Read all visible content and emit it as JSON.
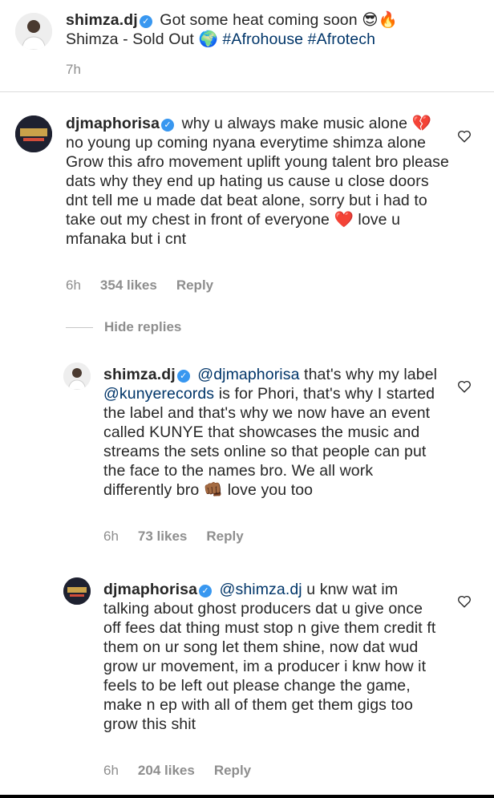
{
  "caption": {
    "username": "shimza.dj",
    "text_part1": "Got some heat coming soon",
    "emoji_part1": "😎🔥",
    "text_part2": "Shimza - Sold Out",
    "emoji_globe": "🌍",
    "hashtag1": "#Afrohouse",
    "hashtag2": "#Afrotech",
    "time": "7h"
  },
  "comments": [
    {
      "username": "djmaphorisa",
      "text_a": "why u always make music alone",
      "emoji_a": "💔",
      "text_b": "no young up coming nyana everytime shimza alone Grow this afro movement uplift young talent bro please dats why they end up hating us cause u close doors dnt tell me u made dat beat alone, sorry but i had to take out my chest in front of everyone",
      "emoji_b": "❤️",
      "text_c": "love u mfanaka but i cnt",
      "time": "6h",
      "likes": "354 likes",
      "reply": "Reply"
    }
  ],
  "hide_replies": "Hide replies",
  "replies": [
    {
      "username": "shimza.dj",
      "mention": "@djmaphorisa",
      "text_a": "that's why my label",
      "mention2": "@kunyerecords",
      "text_b": "is for Phori, that's why I started the label and that's why we now have an event called KUNYE that showcases the music and streams the sets online so that people can put the face to the names bro. We all work differently bro",
      "emoji": "👊🏾",
      "text_c": "love you too",
      "time": "6h",
      "likes": "73 likes",
      "reply": "Reply"
    },
    {
      "username": "djmaphorisa",
      "mention": "@shimza.dj",
      "text_a": "u knw wat im talking about ghost producers dat u give once off fees dat thing must stop n give them credit ft them on ur song let them shine, now dat wud grow ur movement, im a producer i knw how it feels to be left out please change the game, make n ep with all of them get them gigs too grow this shit",
      "time": "6h",
      "likes": "204 likes",
      "reply": "Reply"
    }
  ],
  "colors": {
    "verified": "#3897f0",
    "link": "#003569",
    "meta": "#8e8e8e"
  }
}
